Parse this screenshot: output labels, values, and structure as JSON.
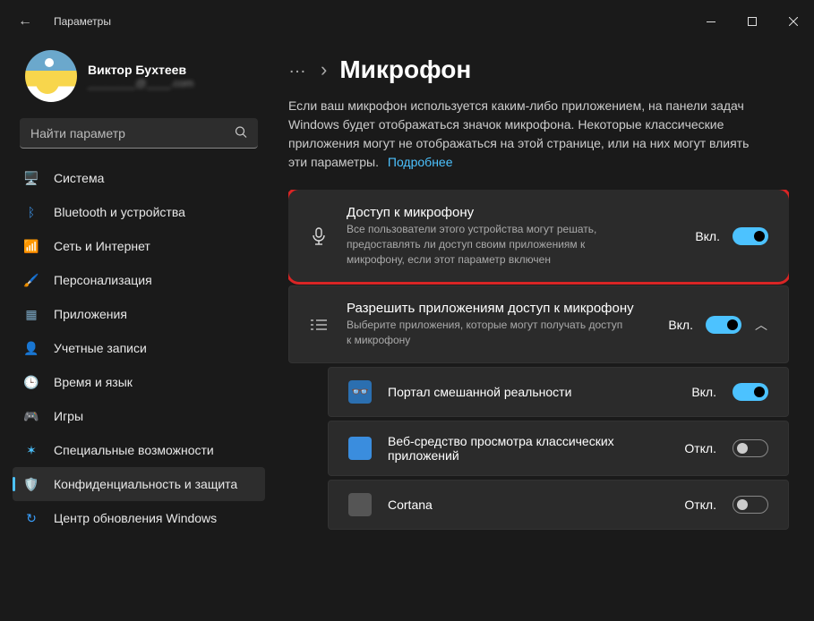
{
  "app_title": "Параметры",
  "profile": {
    "name": "Виктор Бухтеев",
    "sub": "________@____.com"
  },
  "search": {
    "placeholder": "Найти параметр"
  },
  "nav": [
    {
      "key": "system",
      "label": "Система",
      "icon": "🖥️",
      "color": "#3a8dde"
    },
    {
      "key": "bluetooth",
      "label": "Bluetooth и устройства",
      "icon": "ᛒ",
      "color": "#3a8dde"
    },
    {
      "key": "network",
      "label": "Сеть и Интернет",
      "icon": "📶",
      "color": "#3aa0ff"
    },
    {
      "key": "personalization",
      "label": "Персонализация",
      "icon": "🖌️",
      "color": "#ff8a3d"
    },
    {
      "key": "apps",
      "label": "Приложения",
      "icon": "▦",
      "color": "#7aa6c2"
    },
    {
      "key": "accounts",
      "label": "Учетные записи",
      "icon": "👤",
      "color": "#2db37a"
    },
    {
      "key": "timelang",
      "label": "Время и язык",
      "icon": "🕒",
      "color": "#7aa6c2"
    },
    {
      "key": "games",
      "label": "Игры",
      "icon": "🎮",
      "color": "#aaa"
    },
    {
      "key": "accessibility",
      "label": "Специальные возможности",
      "icon": "✶",
      "color": "#4cc2ff"
    },
    {
      "key": "privacy",
      "label": "Конфиденциальность и защита",
      "icon": "🛡️",
      "color": "#999"
    },
    {
      "key": "update",
      "label": "Центр обновления Windows",
      "icon": "↻",
      "color": "#3aa0ff"
    }
  ],
  "nav_active_key": "privacy",
  "breadcrumb": {
    "title": "Микрофон",
    "sep": "›"
  },
  "description": {
    "text": "Если ваш микрофон используется каким-либо приложением, на панели задач Windows будет отображаться значок микрофона. Некоторые классические приложения могут не отображаться на этой странице, или на них могут влиять эти параметры.",
    "link": "Подробнее"
  },
  "settings": {
    "mic_access": {
      "title": "Доступ к микрофону",
      "sub": "Все пользователи этого устройства могут решать, предоставлять ли доступ своим приложениям к микрофону, если этот параметр включен",
      "state_label": "Вкл.",
      "on": true
    },
    "apps_access": {
      "title": "Разрешить приложениям доступ к микрофону",
      "sub": "Выберите приложения, которые могут получать доступ к микрофону",
      "state_label": "Вкл.",
      "on": true,
      "expanded": true
    }
  },
  "apps": [
    {
      "name": "Портал смешанной реальности",
      "sub": "",
      "state_label": "Вкл.",
      "on": true,
      "icon_color": "#2b6fb0",
      "icon": "👓"
    },
    {
      "name": "Веб-средство просмотра классических приложений",
      "sub": "",
      "state_label": "Откл.",
      "on": false,
      "icon_color": "#3a8dde",
      "icon": ""
    },
    {
      "name": "Cortana",
      "sub": "",
      "state_label": "Откл.",
      "on": false,
      "icon_color": "#555",
      "icon": ""
    }
  ],
  "state": {
    "on": "Вкл.",
    "off": "Откл."
  }
}
